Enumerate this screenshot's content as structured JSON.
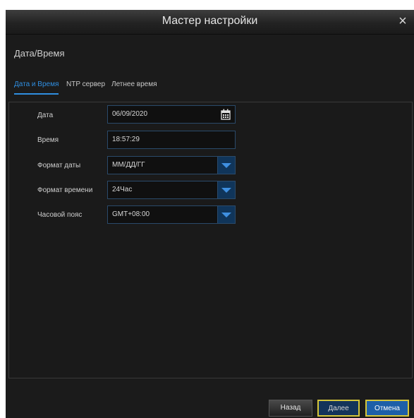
{
  "window": {
    "title": "Мастер настройки",
    "close_label": "×"
  },
  "section": {
    "title": "Дата/Время"
  },
  "tabs": [
    {
      "label": "Дата и Время",
      "active": true
    },
    {
      "label": "NTP сервер",
      "active": false
    },
    {
      "label": "Летнее время",
      "active": false
    }
  ],
  "form": {
    "date": {
      "label": "Дата",
      "value": "06/09/2020"
    },
    "time": {
      "label": "Время",
      "value": "18:57:29"
    },
    "date_format": {
      "label": "Формат даты",
      "value": "ММ/ДД/ГГ"
    },
    "time_format": {
      "label": "Формат времени",
      "value": "24Час"
    },
    "timezone": {
      "label": "Часовой пояс",
      "value": "GMT+08:00"
    }
  },
  "buttons": {
    "back": "Назад",
    "next": "Далее",
    "cancel": "Отмена"
  },
  "colors": {
    "accent": "#2f8ee0",
    "background": "#1b1b1b",
    "focus_border": "#d4c53a"
  },
  "icons": {
    "calendar": "calendar-icon",
    "dropdown": "chevron-down-icon",
    "close": "close-icon"
  }
}
